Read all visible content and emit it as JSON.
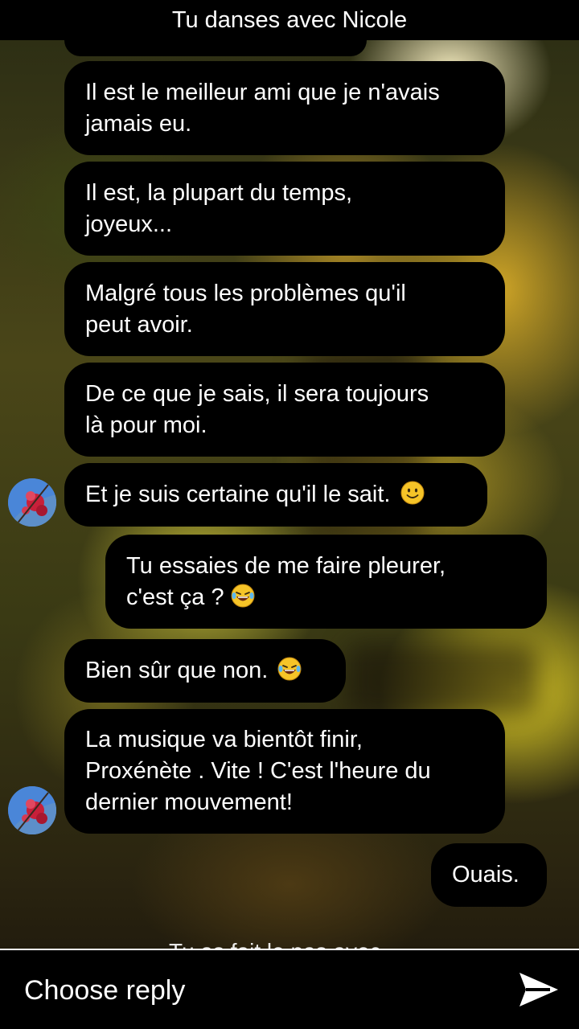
{
  "header": {
    "title": "Tu danses avec Nicole"
  },
  "messages": [
    {
      "text": "Il est le meilleur ami que je n'avais\njamais eu."
    },
    {
      "text": "Il est, la plupart du temps,\njoyeux..."
    },
    {
      "text": "Malgré tous les problèmes qu'il\npeut avoir."
    },
    {
      "text": "De ce que je sais, il sera toujours\nlà pour moi."
    },
    {
      "text": "Et je suis certaine qu'il le sait.",
      "emoji": "smile-emoji"
    },
    {
      "text": "Tu essaies de me faire pleurer,\nc'est ça ?",
      "emoji": "laugh-cry-emoji"
    },
    {
      "text": "Bien sûr que non.",
      "emoji": "laugh-cry-emoji"
    },
    {
      "text": "La musique va bientôt finir,\nProxénète . Vite ! C'est l'heure du\ndernier mouvement!"
    },
    {
      "text": "Ouais."
    }
  ],
  "faded_status": "Tu as fait le pas avec Nicole",
  "footer": {
    "prompt": "Choose reply",
    "send_icon": "send-arrow-icon"
  },
  "colors": {
    "bubble": "#000000",
    "text": "#ffffff",
    "emoji": "#f6c428"
  }
}
